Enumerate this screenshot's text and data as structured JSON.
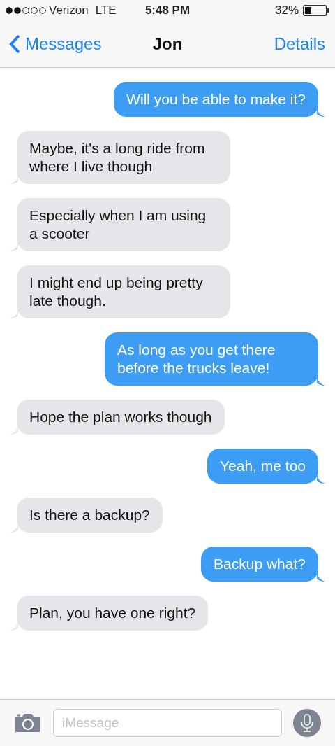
{
  "status_bar": {
    "carrier": "Verizon",
    "network": "LTE",
    "time": "5:48 PM",
    "battery": "32%"
  },
  "nav": {
    "back": "Messages",
    "title": "Jon",
    "action": "Details"
  },
  "messages": [
    {
      "kind": "sent",
      "text": "Will you be able to make it?"
    },
    {
      "kind": "received",
      "text": "Maybe, it's a long ride from where I live though"
    },
    {
      "kind": "received",
      "text": "Especially when I am using a scooter"
    },
    {
      "kind": "received",
      "text": "I might end up being pretty late though."
    },
    {
      "kind": "sent",
      "text": "As long as you get there before the trucks leave!"
    },
    {
      "kind": "received",
      "text": "Hope the plan works though"
    },
    {
      "kind": "sent",
      "text": "Yeah, me too"
    },
    {
      "kind": "received",
      "text": "Is there a backup?"
    },
    {
      "kind": "sent",
      "text": "Backup what?"
    },
    {
      "kind": "received",
      "text": "Plan, you have one right?"
    }
  ],
  "composer": {
    "placeholder": "iMessage"
  }
}
